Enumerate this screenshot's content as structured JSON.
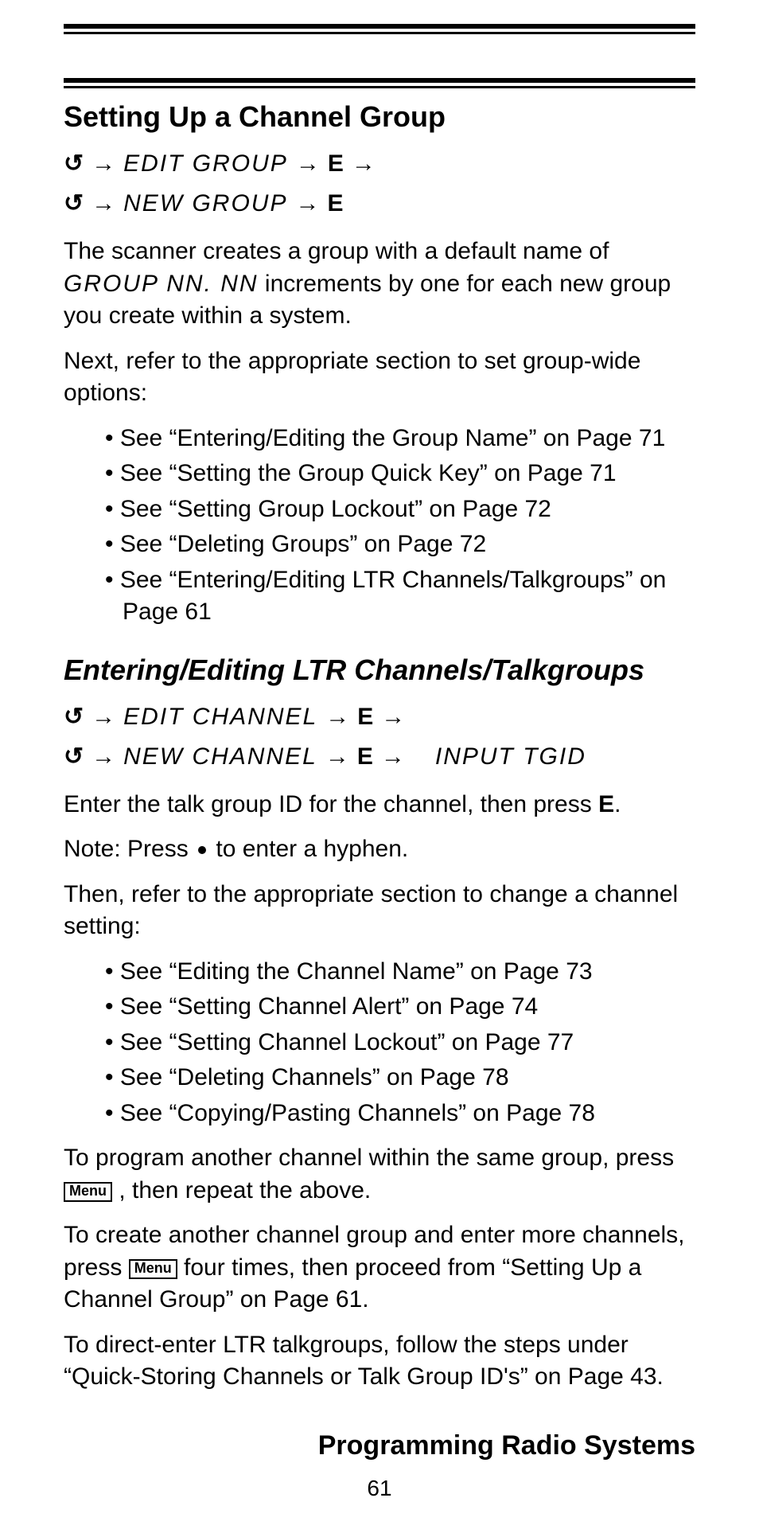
{
  "section1": {
    "heading": "Setting Up a Channel Group",
    "nav1": {
      "lcd": "EDIT GROUP",
      "e": "E"
    },
    "nav2": {
      "lcd": "NEW GROUP",
      "e": "E"
    },
    "para1_pre": "The scanner creates a group with a default name of ",
    "para1_lcd": "GROUP NN. NN",
    "para1_post": " increments by one for each new group you create within a system.",
    "para2": "Next, refer to the appropriate section to set group-wide options:",
    "refs": [
      "See “Entering/Editing the Group Name” on Page 71",
      "See “Setting the Group Quick Key” on Page 71",
      "See “Setting Group Lockout” on Page 72",
      "See “Deleting Groups” on Page 72",
      "See “Entering/Editing LTR Channels/Talkgroups” on Page 61"
    ]
  },
  "section2": {
    "heading": "Entering/Editing LTR Channels/Talkgroups",
    "nav1": {
      "lcd": "EDIT CHANNEL",
      "e": "E"
    },
    "nav2": {
      "lcd": "NEW CHANNEL",
      "e": "E",
      "lcd2": "INPUT TGID"
    },
    "para1_pre": "Enter the talk group ID for the channel, then press ",
    "para1_e": "E",
    "para1_post": ".",
    "note_pre": "Note: Press ",
    "note_post": " to enter a hyphen.",
    "para2": "Then, refer to the appropriate section to change a channel setting:",
    "refs": [
      "See “Editing the Channel Name” on Page 73",
      "See “Setting Channel Alert” on Page 74",
      "See “Setting Channel Lockout” on Page 77",
      "See “Deleting Channels” on Page 78",
      "See “Copying/Pasting Channels” on Page 78"
    ],
    "para3_pre": "To program another channel within the same group, press ",
    "para3_post": " , then repeat the above.",
    "para4_pre": "To create another channel group and enter more channels, press ",
    "para4_post": " four times, then proceed from “Setting Up a Channel Group” on Page 61.",
    "para5": "To direct-enter LTR talkgroups, follow the steps under “Quick-Storing Channels or Talk Group ID's” on Page 43."
  },
  "menu_label": "Menu",
  "footer": {
    "title": "Programming Radio Systems",
    "page": "61"
  }
}
